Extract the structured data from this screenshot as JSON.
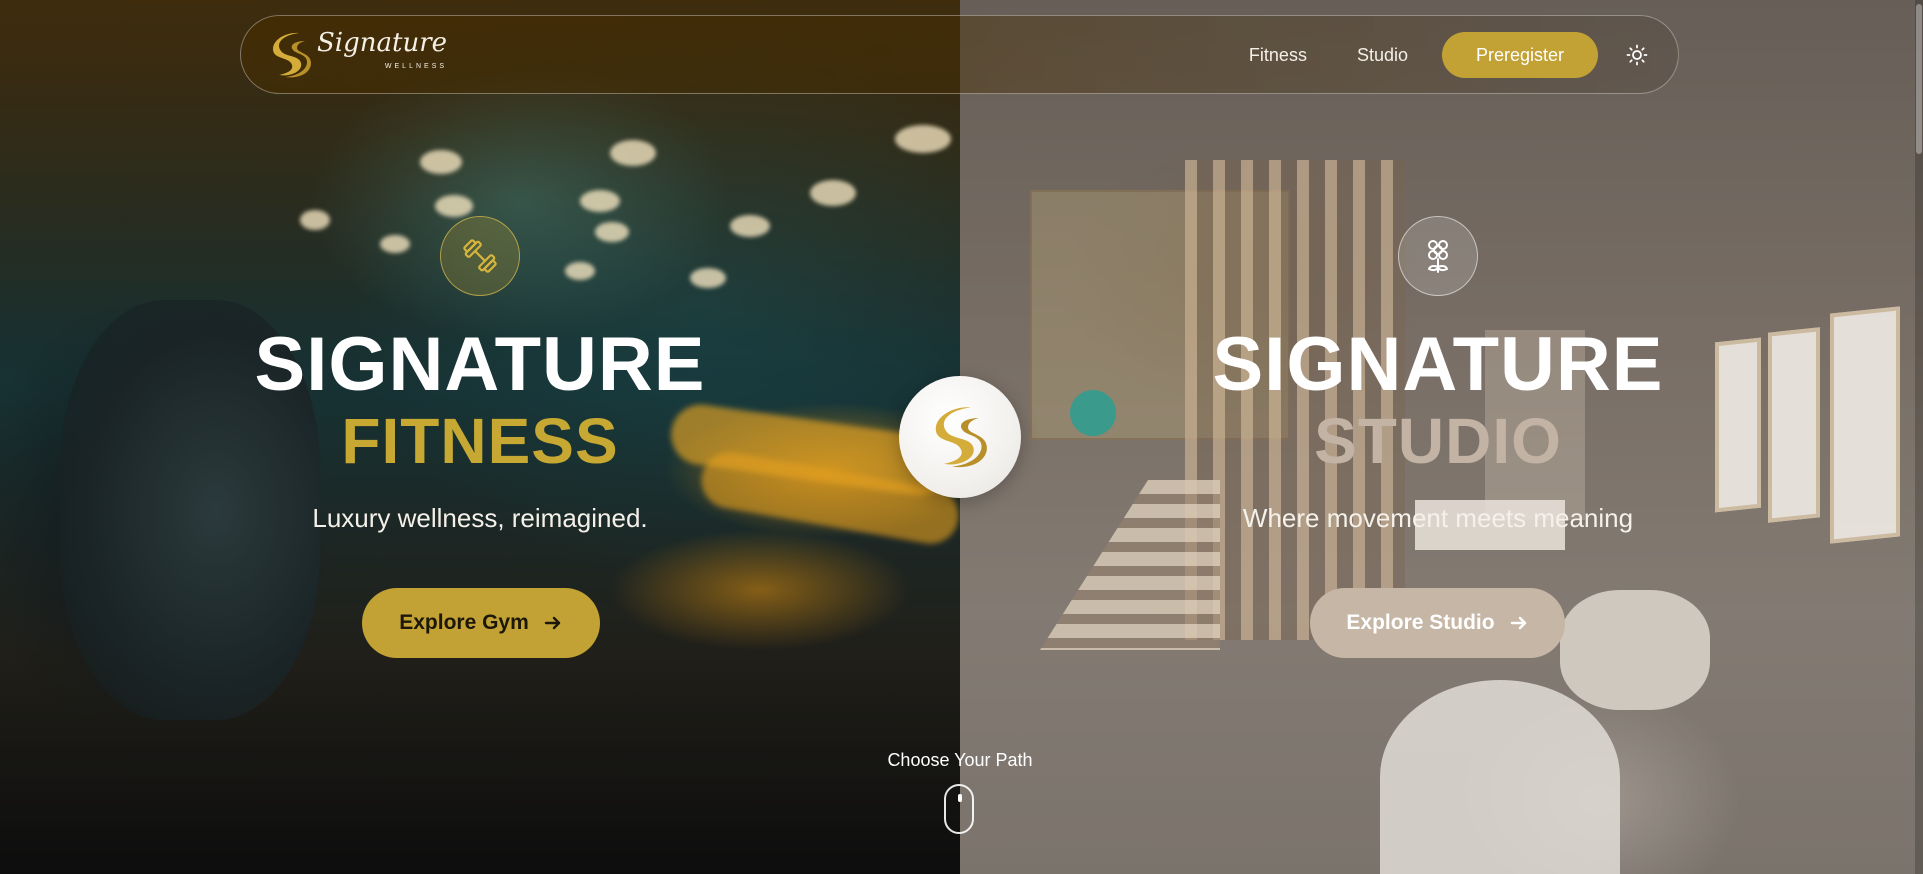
{
  "nav": {
    "logo_text": "Signature",
    "logo_sub": "WELLNESS",
    "links": [
      "Fitness",
      "Studio"
    ],
    "preregister_label": "Preregister",
    "theme_icon": "sun-icon"
  },
  "fitness": {
    "icon": "dumbbell-icon",
    "title": "SIGNATURE",
    "subtitle": "FITNESS",
    "tagline": "Luxury wellness, reimagined.",
    "cta_label": "Explore Gym"
  },
  "studio": {
    "icon": "flower-icon",
    "title": "SIGNATURE",
    "subtitle": "STUDIO",
    "tagline": "Where movement meets meaning",
    "cta_label": "Explore Studio"
  },
  "center": {
    "logo_icon": "signature-s-logo-icon",
    "path_label": "Choose Your Path",
    "scroll_icon": "mouse-scroll-icon"
  },
  "colors": {
    "gold": "#c2a235",
    "taupe": "#c6b6a6",
    "white": "#ffffff"
  }
}
